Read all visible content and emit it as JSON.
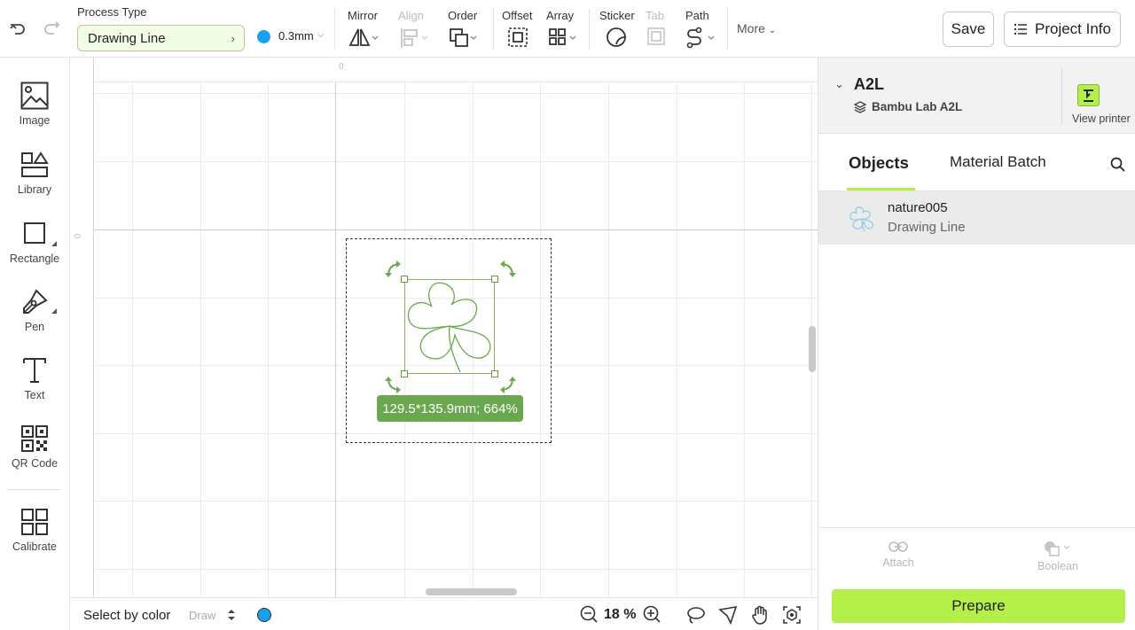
{
  "toolbar": {
    "process_type_label": "Process Type",
    "process_type_value": "Drawing Line",
    "line_size": "0.3mm",
    "line_color": "#1aa0f0",
    "groups": {
      "mirror": "Mirror",
      "align": "Align",
      "order": "Order",
      "offset": "Offset",
      "array": "Array",
      "sticker": "Sticker",
      "tab": "Tab",
      "path": "Path"
    },
    "more_label": "More",
    "save_label": "Save",
    "project_info_label": "Project Info"
  },
  "sidebar": {
    "items": [
      {
        "label": "Image",
        "icon": "image-icon"
      },
      {
        "label": "Library",
        "icon": "library-icon"
      },
      {
        "label": "Rectangle",
        "icon": "rectangle-icon"
      },
      {
        "label": "Pen",
        "icon": "pen-icon"
      },
      {
        "label": "Text",
        "icon": "text-icon"
      },
      {
        "label": "QR Code",
        "icon": "qr-code-icon"
      },
      {
        "label": "Calibrate",
        "icon": "calibrate-icon"
      }
    ]
  },
  "canvas": {
    "ruler_top_zero": "0",
    "ruler_left_zero": "0",
    "selection_size_label": "129.5*135.9mm; 664%",
    "accent_color": "#6aa84f"
  },
  "bottombar": {
    "select_by_color": "Select by color",
    "mode": "Draw",
    "zoom": "18 %"
  },
  "right_panel": {
    "printer_name": "A2L",
    "printer_model": "Bambu Lab A2L",
    "view_printer_label": "View printer",
    "tabs": [
      "Objects",
      "Material Batch"
    ],
    "objects": [
      {
        "name": "nature005",
        "type": "Drawing Line"
      }
    ],
    "attach_label": "Attach",
    "boolean_label": "Boolean",
    "prepare_label": "Prepare",
    "prepare_color": "#b5ef4a"
  }
}
